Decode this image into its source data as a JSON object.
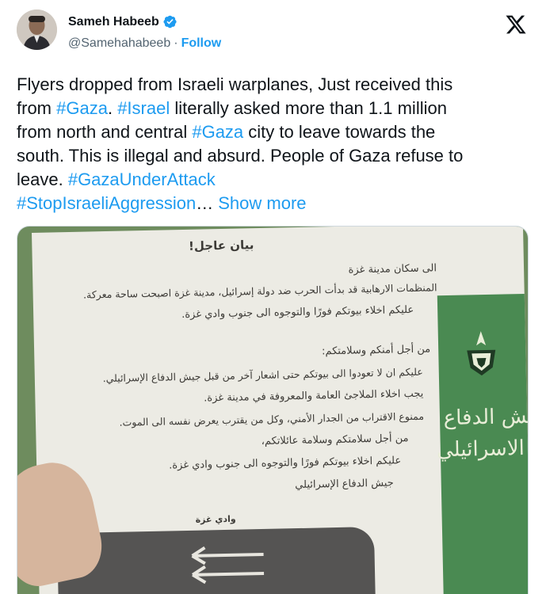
{
  "author": {
    "display_name": "Sameh Habeeb",
    "handle": "@Samehahabeeb",
    "separator": "·",
    "follow_label": "Follow"
  },
  "tweet": {
    "line1": "Flyers dropped from Israeli warplanes, Just received this",
    "l2_pre": "from ",
    "l2_tag1": "#Gaza",
    "l2_mid": ". ",
    "l2_tag2": "#Israel",
    "l2_post": " literally asked more than 1.1 million",
    "l3_pre": "from north and central ",
    "l3_tag": "#Gaza",
    "l3_post": " city to leave towards the",
    "line4": "south. This is illegal and absurd. People of Gaza refuse to",
    "l5_pre": "leave. ",
    "l5_tag": "#GazaUnderAttack",
    "l6_tag": "#StopIsraeliAggression",
    "ellipsis": "…",
    "show_more": "Show more"
  },
  "flyer": {
    "title": "بيان عاجل!",
    "line1": "الى سكان مدينة غزة",
    "line2": "المنظمات الارهابية قد بدأت الحرب ضد دولة إسرائيل، مدينة غزة اصبحت ساحة معركة.",
    "line3": "عليكم اخلاء بيوتكم فورًا والتوجوه الى جنوب وادي غزة.",
    "line4": "من أجل أمنكم وسلامتكم:",
    "bullet1": "عليكم ان لا تعودوا الى بيوتكم حتى اشعار آخر من قبل جيش الدفاع الإسرائيلي.",
    "bullet2": "يجب اخلاء الملاجئ العامة والمعروفة في مدينة غزة.",
    "bullet3": "ممنوع الاقتراب من الجدار الأمني، وكل من يقترب يعرض نفسه الى الموت.",
    "line5": "من أجل سلامتكم وسلامة عائلاتكم،",
    "line6": "عليكم اخلاء بيوتكم فورًا والتوجوه الى جنوب وادي غزة.",
    "line7": "جيش الدفاع الإسرائيلي",
    "map_label": "وادي غزة",
    "side_label1": "يش الدفاع",
    "side_label2": "الاسرائيلي"
  },
  "colors": {
    "accent": "#1d9bf0",
    "text": "#0f1419",
    "muted": "#536471"
  },
  "icons": {
    "verified": "verified-badge-icon",
    "x": "x-logo-icon"
  }
}
